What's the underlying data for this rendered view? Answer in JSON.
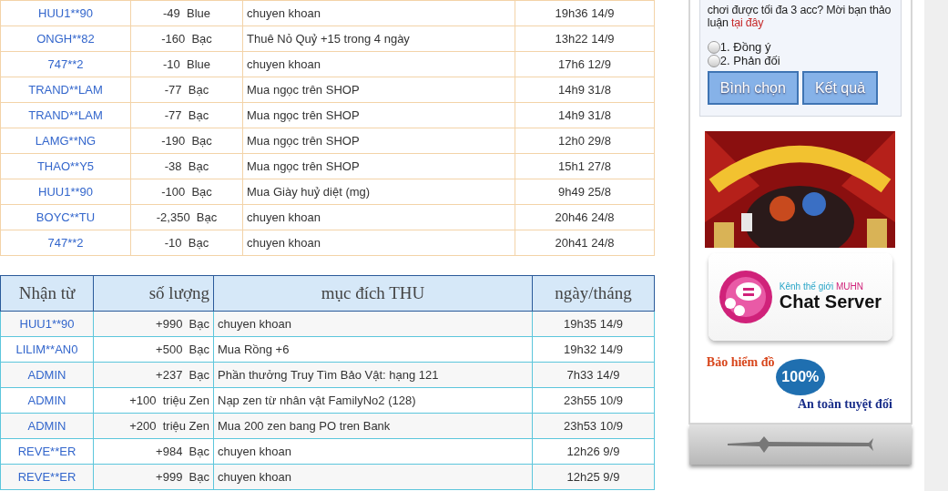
{
  "spend_table": {
    "rows": [
      {
        "name": "HUU1**90",
        "amount": "-49  Blue",
        "purpose": "chuyen khoan",
        "time": "19h36 14/9"
      },
      {
        "name": "ONGH**82",
        "amount": "-160  Bạc",
        "purpose": "Thuê Nỏ Quỷ +15 trong 4 ngày",
        "time": "13h22 14/9"
      },
      {
        "name": "747**2",
        "amount": "-10  Blue",
        "purpose": "chuyen khoan",
        "time": "17h6 12/9"
      },
      {
        "name": "TRAND**LAM",
        "amount": "-77  Bạc",
        "purpose": "Mua ngọc trên SHOP",
        "time": "14h9 31/8"
      },
      {
        "name": "TRAND**LAM",
        "amount": "-77  Bạc",
        "purpose": "Mua ngọc trên SHOP",
        "time": "14h9 31/8"
      },
      {
        "name": "LAMG**NG",
        "amount": "-190  Bạc",
        "purpose": "Mua ngọc trên SHOP",
        "time": "12h0 29/8"
      },
      {
        "name": "THAO**Y5",
        "amount": "-38  Bạc",
        "purpose": "Mua ngọc trên SHOP",
        "time": "15h1 27/8"
      },
      {
        "name": "HUU1**90",
        "amount": "-100  Bạc",
        "purpose": "Mua Giày huỷ diệt (mg)",
        "time": "9h49 25/8"
      },
      {
        "name": "BOYC**TU",
        "amount": "-2,350  Bạc",
        "purpose": "chuyen khoan",
        "time": "20h46 24/8"
      },
      {
        "name": "747**2",
        "amount": "-10  Bạc",
        "purpose": "chuyen khoan",
        "time": "20h41 24/8"
      }
    ]
  },
  "receive_table": {
    "columns": [
      "Nhận từ",
      "số lượng",
      "mục đích THU",
      "ngày/tháng"
    ],
    "rows": [
      {
        "name": "HUU1**90",
        "amount": "+990  Bạc",
        "purpose": "chuyen khoan",
        "time": "19h35 14/9"
      },
      {
        "name": "LILIM**AN0",
        "amount": "+500  Bạc",
        "purpose": "Mua Rồng +6",
        "time": "19h32 14/9"
      },
      {
        "name": "ADMIN",
        "amount": "+237  Bạc",
        "purpose": "Phần thưởng Truy Tìm Bảo Vật: hạng 121",
        "time": "7h33 14/9"
      },
      {
        "name": "ADMIN",
        "amount": "+100  triệu Zen",
        "purpose": "Nạp zen từ nhân vật FamilyNo2 (128)",
        "time": "23h55 10/9"
      },
      {
        "name": "ADMIN",
        "amount": "+200  triệu Zen",
        "purpose": "Mua 200 zen bang PO tren Bank",
        "time": "23h53 10/9"
      },
      {
        "name": "REVE**ER",
        "amount": "+984  Bạc",
        "purpose": "chuyen khoan",
        "time": "12h26 9/9"
      },
      {
        "name": "REVE**ER",
        "amount": "+999  Bạc",
        "purpose": "chuyen khoan",
        "time": "12h25 9/9"
      }
    ]
  },
  "poll": {
    "question": "chơi được tối đa 3 acc? Mời bạn thảo luận",
    "link": "tại đây",
    "options": [
      {
        "label": "1. Đồng ý",
        "selected": false
      },
      {
        "label": "2. Phản đối",
        "selected": false
      }
    ],
    "buttons": [
      "Bình chọn",
      "Kết quả"
    ]
  },
  "chat_banner": {
    "subtitle_prefix": "Kênh thế giới",
    "subtitle_brand": "MUHN",
    "title": "Chat Server"
  },
  "insurance_banner": {
    "top": "Bảo hiểm đồ",
    "badge": "100%",
    "bottom": "An toàn tuyệt đối"
  }
}
